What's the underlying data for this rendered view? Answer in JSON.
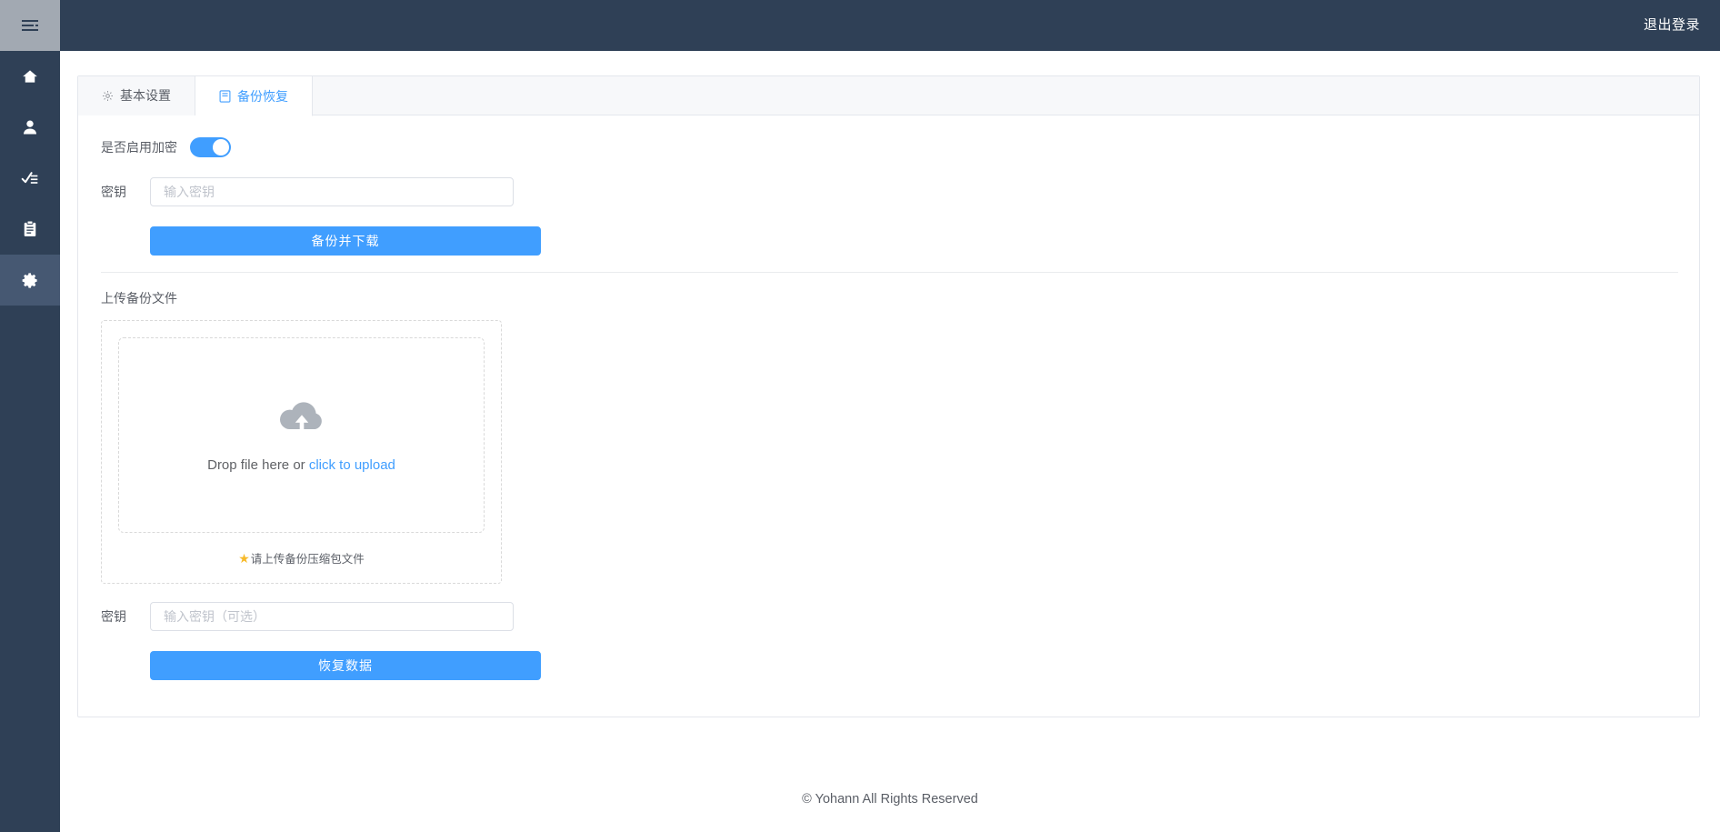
{
  "sidebar": {
    "toggle": {
      "name": "menu-toggle",
      "icon": "hamburger-icon"
    },
    "items": [
      {
        "icon": "home-icon",
        "name": "sidebar-item-home",
        "active": false
      },
      {
        "icon": "user-icon",
        "name": "sidebar-item-user",
        "active": false
      },
      {
        "icon": "checklist-icon",
        "name": "sidebar-item-tasks",
        "active": false
      },
      {
        "icon": "clipboard-icon",
        "name": "sidebar-item-records",
        "active": false
      },
      {
        "icon": "gear-icon",
        "name": "sidebar-item-settings",
        "active": true
      }
    ]
  },
  "header": {
    "logout_label": "退出登录"
  },
  "tabs": [
    {
      "label": "基本设置",
      "icon": "gear-icon",
      "active": false
    },
    {
      "label": "备份恢复",
      "icon": "document-icon",
      "active": true
    }
  ],
  "backup": {
    "encrypt_label": "是否启用加密",
    "encrypt_enabled": true,
    "key_label": "密钥",
    "key_value": "",
    "key_placeholder": "输入密钥",
    "download_button": "备份并下载"
  },
  "upload": {
    "section_label": "上传备份文件",
    "drop_text_prefix": "Drop file here or ",
    "drop_link_text": "click to upload",
    "tip_star": "★",
    "tip_text": "请上传备份压缩包文件",
    "upload_icon": "cloud-upload-icon"
  },
  "restore": {
    "key_label": "密钥",
    "key_value": "",
    "key_placeholder": "输入密钥（可选）",
    "restore_button": "恢复数据"
  },
  "footer": {
    "copyright": "© Yohann All Rights Reserved"
  },
  "colors": {
    "sidebar_bg": "#2f4056",
    "sidebar_active": "#465872",
    "toggle_bg": "#a2a9b2",
    "primary": "#409eff",
    "star": "#f7ba2a",
    "text": "#5a5e66"
  }
}
